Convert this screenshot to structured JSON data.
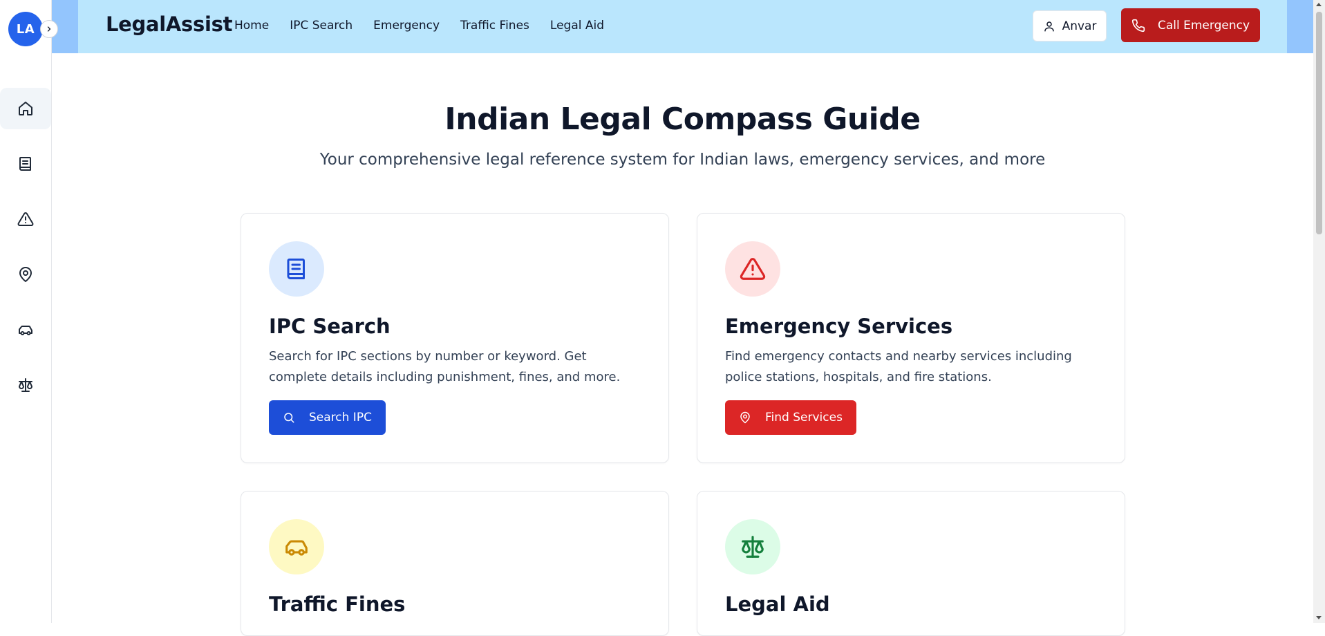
{
  "sidebar": {
    "avatar_initials": "LA",
    "items": [
      {
        "name": "home",
        "icon": "home-icon"
      },
      {
        "name": "ipc",
        "icon": "book-icon"
      },
      {
        "name": "emergency",
        "icon": "alert-triangle-icon"
      },
      {
        "name": "location",
        "icon": "map-pin-icon"
      },
      {
        "name": "traffic",
        "icon": "car-icon"
      },
      {
        "name": "legal-aid",
        "icon": "scale-icon"
      }
    ]
  },
  "header": {
    "brand": "LegalAssist",
    "nav": [
      "Home",
      "IPC Search",
      "Emergency",
      "Traffic Fines",
      "Legal Aid"
    ],
    "user_label": "Anvar",
    "call_label": "Call Emergency"
  },
  "hero": {
    "title": "Indian Legal Compass Guide",
    "subtitle": "Your comprehensive legal reference system for Indian laws, emergency services, and more"
  },
  "cards": [
    {
      "title": "IPC Search",
      "description": "Search for IPC sections by number or keyword. Get complete details including punishment, fines, and more.",
      "button": "Search IPC",
      "icon": "book-icon",
      "button_icon": "search-icon"
    },
    {
      "title": "Emergency Services",
      "description": "Find emergency contacts and nearby services including police stations, hospitals, and fire stations.",
      "button": "Find Services",
      "icon": "alert-triangle-icon",
      "button_icon": "map-pin-icon"
    },
    {
      "title": "Traffic Fines",
      "icon": "car-icon"
    },
    {
      "title": "Legal Aid",
      "icon": "scale-icon"
    }
  ],
  "colors": {
    "header_bg": "#bae6fd",
    "call_button": "#b91c1c",
    "primary_blue": "#1d4ed8",
    "danger_red": "#dc2626",
    "blue_tint": "#dbeafe",
    "red_tint": "#fee2e2",
    "yellow_tint": "#fef9c3",
    "green_tint": "#dcfce7"
  }
}
